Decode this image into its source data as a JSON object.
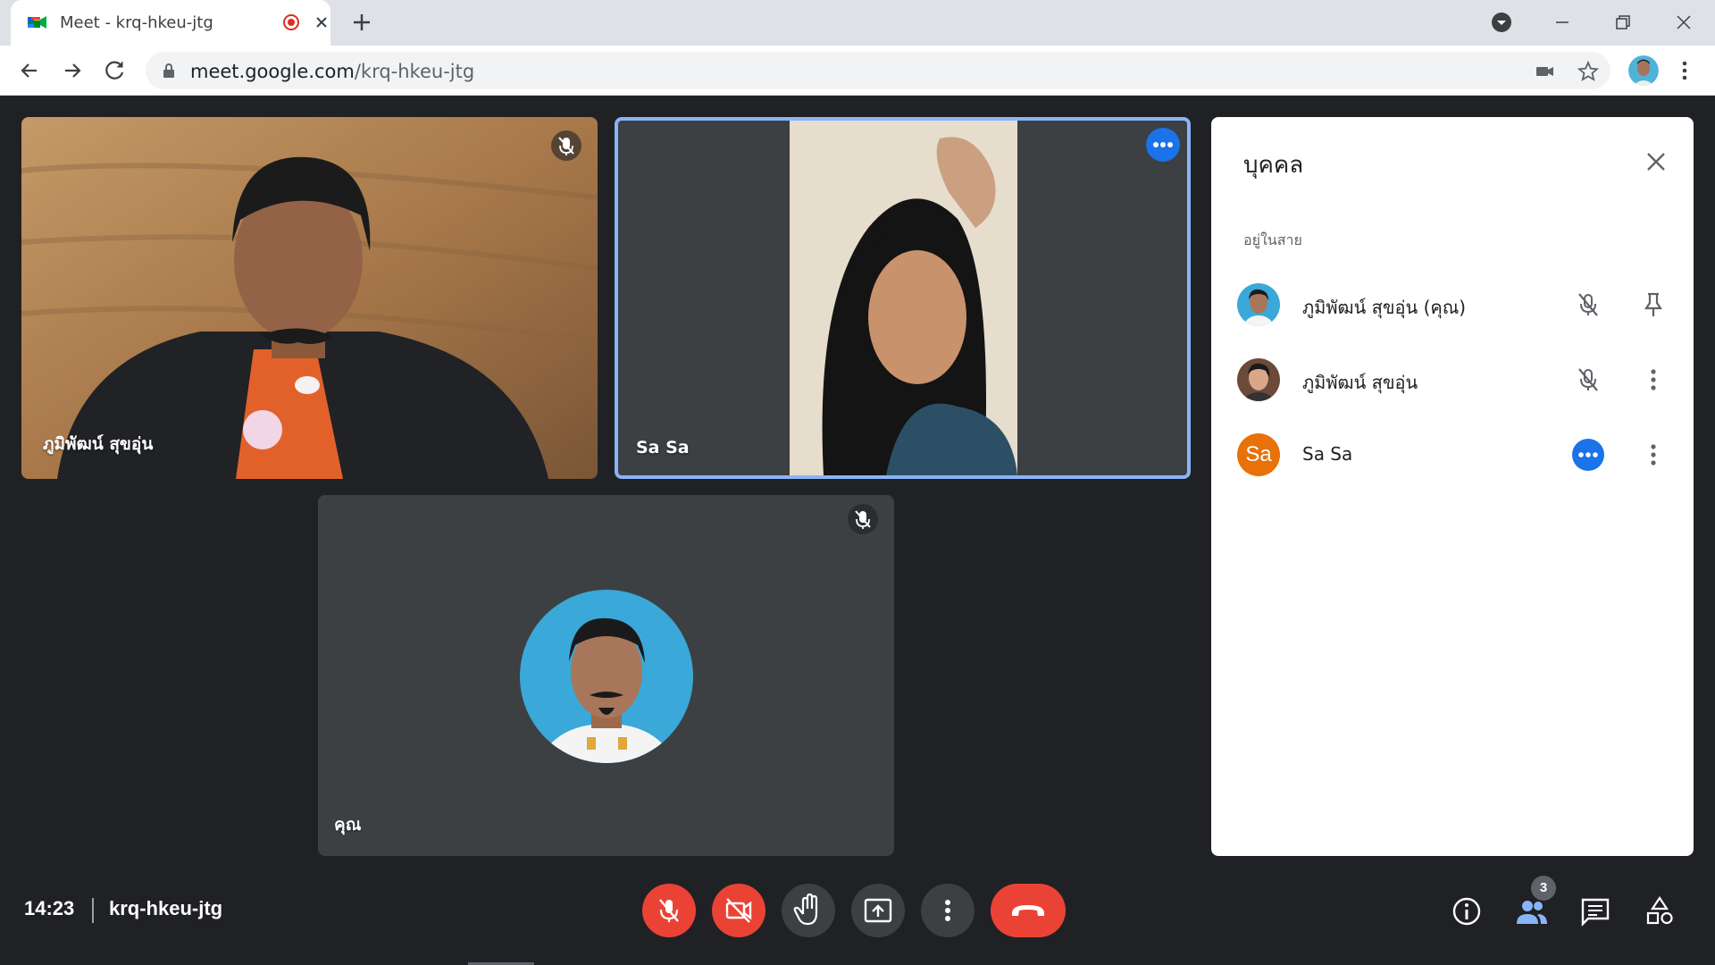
{
  "browser": {
    "tab_title": "Meet - krq-hkeu-jtg",
    "url_domain": "meet.google.com",
    "url_path": "/krq-hkeu-jtg"
  },
  "tiles": [
    {
      "name": "ภูมิพัฒน์ สุขอุ่น",
      "muted": true
    },
    {
      "name": "Sa Sa",
      "active_speaker": true
    },
    {
      "name": "คุณ",
      "muted": true
    }
  ],
  "panel": {
    "title": "บุคคล",
    "section": "อยู่ในสาย",
    "people": [
      {
        "name": "ภูมิพัฒน์ สุขอุ่น (คุณ)",
        "avatar_text": ""
      },
      {
        "name": "ภูมิพัฒน์ สุขอุ่น",
        "avatar_text": ""
      },
      {
        "name": "Sa Sa",
        "avatar_text": "Sa"
      }
    ]
  },
  "bottom": {
    "time": "14:23",
    "meeting_code": "krq-hkeu-jtg",
    "participant_count": "3"
  },
  "colors": {
    "accent": "#1a73e8",
    "danger": "#ea4335",
    "background": "#202124",
    "tile": "#3c4043",
    "avatar_orange": "#e8710a"
  }
}
